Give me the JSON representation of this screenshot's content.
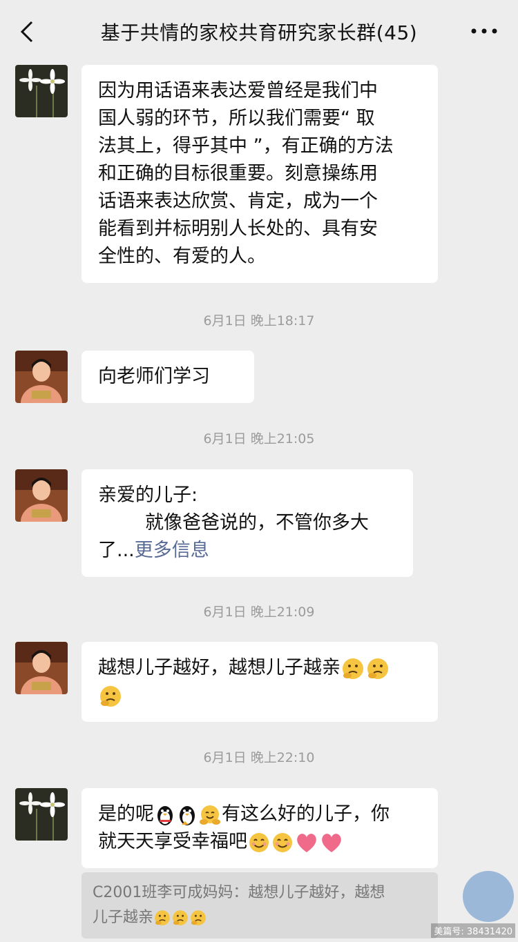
{
  "header": {
    "title": "基于共情的家校共育研究家长群(45)"
  },
  "messages": [
    {
      "avatar": "lily-avatar",
      "lines": [
        "因为用话语来表达爱曾经是我们中",
        "国人弱的环节，所以我们需要“ 取",
        "法其上，得乎其中 ”，有正确的方法",
        "和正确的目标很重要。刻意操练用",
        "话语来表达欣赏、肯定，成为一个",
        "能看到并标明别人长处的、具有安",
        "全性的、有爱的人。"
      ]
    },
    {
      "timestamp": "6月1日 晚上18:17"
    },
    {
      "avatar": "woman-avatar",
      "text": "向老师们学习"
    },
    {
      "timestamp": "6月1日 晚上21:05"
    },
    {
      "avatar": "woman-avatar",
      "line1": "亲爱的儿子:",
      "line2": "就像爸爸说的，不管你多大",
      "line3": "了...",
      "more_link": "更多信息"
    },
    {
      "timestamp": "6月1日 晚上21:09"
    },
    {
      "avatar": "woman-avatar",
      "text": "越想儿子越好，越想儿子越亲",
      "emojis": [
        "thinking-face",
        "thinking-face",
        "thinking-face"
      ]
    },
    {
      "timestamp": "6月1日 晚上22:10"
    },
    {
      "avatar": "lily-avatar",
      "line1_a": "是的呢",
      "line1_b": "有这么好的儿子，你",
      "line2": "就天天享受幸福吧",
      "emojis": [
        "penguin",
        "penguin",
        "hug-face",
        "smile-face",
        "smile-face",
        "heart",
        "heart"
      ]
    }
  ],
  "quote": {
    "line1": "C2001班李可成妈妈：越想儿子越好，越想",
    "line2": "儿子越亲"
  },
  "watermark": {
    "text": "美篇号: 38431420"
  }
}
